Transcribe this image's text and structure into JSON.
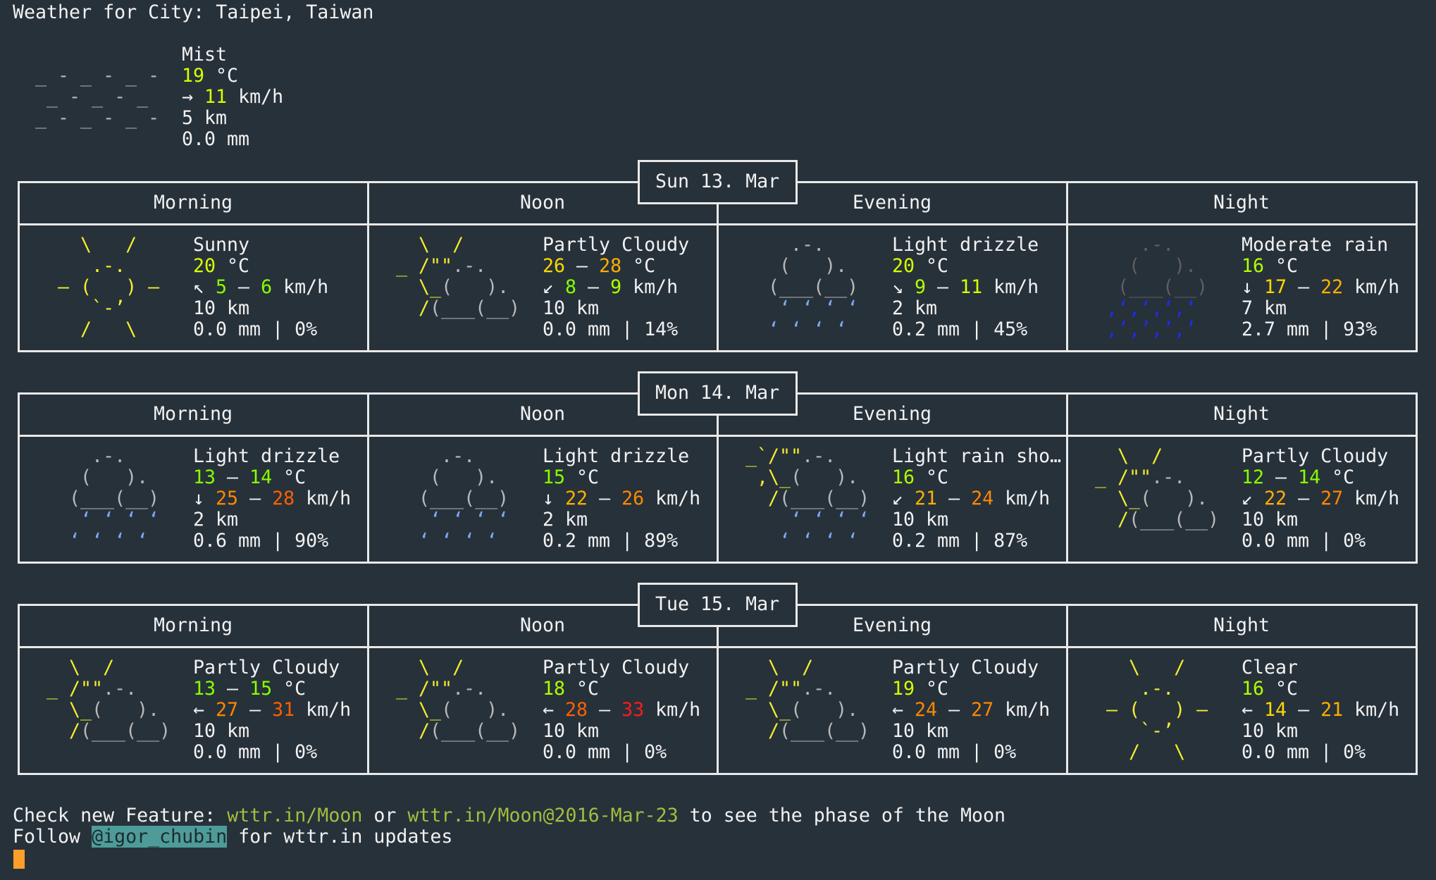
{
  "title": "Weather for City: Taipei, Taiwan",
  "palette": {
    "y": "#f3ee2c",
    "g": "#b8b8b8",
    "dg": "#5f5f5f",
    "lb": "#7fa9f5",
    "db": "#1d2cf0"
  },
  "icons": {
    "fog": [
      [
        [
          " ",
          "g"
        ]
      ],
      [
        [
          " _ - _ - _ - ",
          "g"
        ]
      ],
      [
        [
          "  _ - _ - _  ",
          "g"
        ]
      ],
      [
        [
          " _ - _ - _ - ",
          "g"
        ]
      ],
      [
        [
          " ",
          "g"
        ]
      ]
    ],
    "sunny": [
      [
        [
          "    \\   /    ",
          "y"
        ]
      ],
      [
        [
          "     .-.     ",
          "y"
        ]
      ],
      [
        [
          "  ― (   ) ―  ",
          "y"
        ]
      ],
      [
        [
          "     `-’     ",
          "y"
        ]
      ],
      [
        [
          "    /   \\    ",
          "y"
        ]
      ]
    ],
    "partly_cloudy": [
      [
        [
          "   \\  /      ",
          "y"
        ]
      ],
      [
        [
          " _ /\"\"",
          "y"
        ],
        [
          ".-.    ",
          "g"
        ]
      ],
      [
        [
          "   \\_",
          "y"
        ],
        [
          "(   ).  ",
          "g"
        ]
      ],
      [
        [
          "   /",
          "y"
        ],
        [
          "(___(__) ",
          "g"
        ]
      ],
      [
        [
          " ",
          "g"
        ]
      ]
    ],
    "light_rain": [
      [
        [
          "     .-.     ",
          "g"
        ]
      ],
      [
        [
          "    (   ).   ",
          "g"
        ]
      ],
      [
        [
          "   (___(__)  ",
          "g"
        ]
      ],
      [
        [
          "    ʻ ʻ ʻ ʻ  ",
          "lb"
        ]
      ],
      [
        [
          "   ʻ ʻ ʻ ʻ   ",
          "lb"
        ]
      ]
    ],
    "heavy_rain": [
      [
        [
          "     .-.     ",
          "dg"
        ]
      ],
      [
        [
          "    (   ).   ",
          "dg"
        ]
      ],
      [
        [
          "   (___(__)  ",
          "dg"
        ]
      ],
      [
        [
          "  ‚ʻ‚ʻ‚ʻ‚ʻ   ",
          "db"
        ]
      ],
      [
        [
          "  ‚’‚’‚’‚’   ",
          "db"
        ]
      ]
    ],
    "light_showers": [
      [
        [
          " _`/\"\"",
          "y"
        ],
        [
          ".-.    ",
          "g"
        ]
      ],
      [
        [
          "  ,\\_",
          "y"
        ],
        [
          "(   ).  ",
          "g"
        ]
      ],
      [
        [
          "   /",
          "y"
        ],
        [
          "(___(__) ",
          "g"
        ]
      ],
      [
        [
          "     ʻ ʻ ʻ ʻ ",
          "lb"
        ]
      ],
      [
        [
          "    ʻ ʻ ʻ ʻ  ",
          "lb"
        ]
      ]
    ]
  },
  "current": {
    "icon": "fog",
    "condition": "Mist",
    "temp": [
      {
        "v": "19",
        "c": "#d7ff00"
      }
    ],
    "temp_unit": "°C",
    "wind_dir": "→",
    "wind": [
      {
        "v": "11",
        "c": "#d7ff00"
      }
    ],
    "wind_unit": "km/h",
    "visibility": "5 km",
    "precip": "0.0 mm"
  },
  "days": [
    {
      "date": "Sun 13. Mar",
      "periods": [
        {
          "name": "Morning",
          "icon": "sunny",
          "condition": "Sunny",
          "temp": [
            {
              "v": "20",
              "c": "#d7ff00"
            }
          ],
          "wind_dir": "↖",
          "wind": [
            {
              "v": "5",
              "c": "#87ff00"
            },
            {
              "v": "6",
              "c": "#87ff00"
            }
          ],
          "visibility": "10 km",
          "precip": "0.0 mm",
          "chance": "0%"
        },
        {
          "name": "Noon",
          "icon": "partly_cloudy",
          "condition": "Partly Cloudy",
          "temp": [
            {
              "v": "26",
              "c": "#ffd700"
            },
            {
              "v": "28",
              "c": "#ffaf00"
            }
          ],
          "wind_dir": "↙",
          "wind": [
            {
              "v": "8",
              "c": "#87ff00"
            },
            {
              "v": "9",
              "c": "#afff00"
            }
          ],
          "visibility": "10 km",
          "precip": "0.0 mm",
          "chance": "14%"
        },
        {
          "name": "Evening",
          "icon": "light_rain",
          "condition": "Light drizzle",
          "temp": [
            {
              "v": "20",
              "c": "#d7ff00"
            }
          ],
          "wind_dir": "↘",
          "wind": [
            {
              "v": "9",
              "c": "#afff00"
            },
            {
              "v": "11",
              "c": "#d7ff00"
            }
          ],
          "visibility": "2 km",
          "precip": "0.2 mm",
          "chance": "45%"
        },
        {
          "name": "Night",
          "icon": "heavy_rain",
          "condition": "Moderate rain",
          "temp": [
            {
              "v": "16",
              "c": "#afff00"
            }
          ],
          "wind_dir": "↓",
          "wind": [
            {
              "v": "17",
              "c": "#ffd700"
            },
            {
              "v": "22",
              "c": "#ffaf00"
            }
          ],
          "visibility": "7 km",
          "precip": "2.7 mm",
          "chance": "93%"
        }
      ]
    },
    {
      "date": "Mon 14. Mar",
      "periods": [
        {
          "name": "Morning",
          "icon": "light_rain",
          "condition": "Light drizzle",
          "temp": [
            {
              "v": "13",
              "c": "#87ff00"
            },
            {
              "v": "14",
              "c": "#87ff00"
            }
          ],
          "wind_dir": "↓",
          "wind": [
            {
              "v": "25",
              "c": "#ff8700"
            },
            {
              "v": "28",
              "c": "#ff5f00"
            }
          ],
          "visibility": "2 km",
          "precip": "0.6 mm",
          "chance": "90%"
        },
        {
          "name": "Noon",
          "icon": "light_rain",
          "condition": "Light drizzle",
          "temp": [
            {
              "v": "15",
              "c": "#87ff00"
            }
          ],
          "wind_dir": "↓",
          "wind": [
            {
              "v": "22",
              "c": "#ffaf00"
            },
            {
              "v": "26",
              "c": "#ff8700"
            }
          ],
          "visibility": "2 km",
          "precip": "0.2 mm",
          "chance": "89%"
        },
        {
          "name": "Evening",
          "icon": "light_showers",
          "condition": "Light rain sho…",
          "temp": [
            {
              "v": "16",
              "c": "#afff00"
            }
          ],
          "wind_dir": "↙",
          "wind": [
            {
              "v": "21",
              "c": "#ffaf00"
            },
            {
              "v": "24",
              "c": "#ff8700"
            }
          ],
          "visibility": "10 km",
          "precip": "0.2 mm",
          "chance": "87%"
        },
        {
          "name": "Night",
          "icon": "partly_cloudy",
          "condition": "Partly Cloudy",
          "temp": [
            {
              "v": "12",
              "c": "#87ff00"
            },
            {
              "v": "14",
              "c": "#87ff00"
            }
          ],
          "wind_dir": "↙",
          "wind": [
            {
              "v": "22",
              "c": "#ffaf00"
            },
            {
              "v": "27",
              "c": "#ff8700"
            }
          ],
          "visibility": "10 km",
          "precip": "0.0 mm",
          "chance": "0%"
        }
      ]
    },
    {
      "date": "Tue 15. Mar",
      "periods": [
        {
          "name": "Morning",
          "icon": "partly_cloudy",
          "condition": "Partly Cloudy",
          "temp": [
            {
              "v": "13",
              "c": "#87ff00"
            },
            {
              "v": "15",
              "c": "#87ff00"
            }
          ],
          "wind_dir": "←",
          "wind": [
            {
              "v": "27",
              "c": "#ff8700"
            },
            {
              "v": "31",
              "c": "#ff5f00"
            }
          ],
          "visibility": "10 km",
          "precip": "0.0 mm",
          "chance": "0%"
        },
        {
          "name": "Noon",
          "icon": "partly_cloudy",
          "condition": "Partly Cloudy",
          "temp": [
            {
              "v": "18",
              "c": "#afff00"
            }
          ],
          "wind_dir": "←",
          "wind": [
            {
              "v": "28",
              "c": "#ff5f00"
            },
            {
              "v": "33",
              "c": "#ff1a1a"
            }
          ],
          "visibility": "10 km",
          "precip": "0.0 mm",
          "chance": "0%"
        },
        {
          "name": "Evening",
          "icon": "partly_cloudy",
          "condition": "Partly Cloudy",
          "temp": [
            {
              "v": "19",
              "c": "#d7ff00"
            }
          ],
          "wind_dir": "←",
          "wind": [
            {
              "v": "24",
              "c": "#ff8700"
            },
            {
              "v": "27",
              "c": "#ff8700"
            }
          ],
          "visibility": "10 km",
          "precip": "0.0 mm",
          "chance": "0%"
        },
        {
          "name": "Night",
          "icon": "sunny",
          "condition": "Clear",
          "temp": [
            {
              "v": "16",
              "c": "#afff00"
            }
          ],
          "wind_dir": "←",
          "wind": [
            {
              "v": "14",
              "c": "#ffd700"
            },
            {
              "v": "21",
              "c": "#ffaf00"
            }
          ],
          "visibility": "10 km",
          "precip": "0.0 mm",
          "chance": "0%"
        }
      ]
    }
  ],
  "footer": {
    "line1_prefix": "Check new Feature: ",
    "link1": "wttr.in/Moon",
    "or": " or ",
    "link2": "wttr.in/Moon@2016-Mar-23",
    "line1_suffix": " to see the phase of the Moon",
    "line2_prefix": "Follow ",
    "handle": "@igor_chubin",
    "line2_suffix": " for wttr.in updates"
  },
  "cursor_color": "#ff9f2a"
}
